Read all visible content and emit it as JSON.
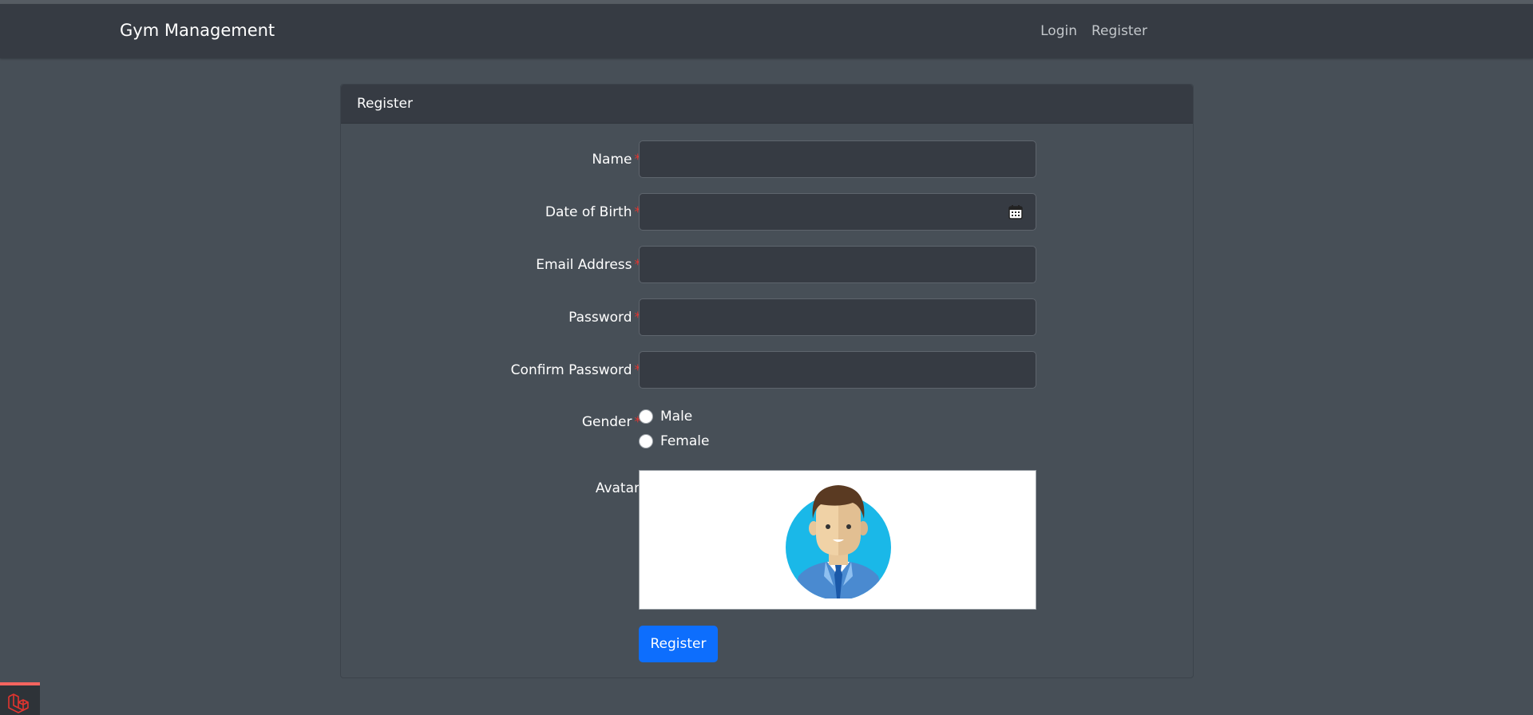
{
  "navbar": {
    "brand": "Gym Management",
    "links": [
      {
        "label": "Login"
      },
      {
        "label": "Register"
      }
    ]
  },
  "card": {
    "title": "Register"
  },
  "form": {
    "fields": [
      {
        "label": "Name",
        "required_mark": "*",
        "value": ""
      },
      {
        "label": "Date of Birth",
        "required_mark": "*",
        "value": "",
        "icon": "calendar-icon"
      },
      {
        "label": "Email Address",
        "required_mark": "*",
        "value": ""
      },
      {
        "label": "Password",
        "required_mark": "*",
        "value": ""
      },
      {
        "label": "Confirm Password",
        "required_mark": "*",
        "value": ""
      }
    ],
    "gender": {
      "label": "Gender",
      "required_mark": "*",
      "options": [
        "Male",
        "Female"
      ]
    },
    "avatar": {
      "label": "Avatar"
    },
    "submit_label": "Register"
  },
  "colors": {
    "background": "#474f57",
    "navbar": "#363b43",
    "required": "#e3342f",
    "primary_button": "#0d6efd",
    "debug_accent": "#f4645f"
  }
}
